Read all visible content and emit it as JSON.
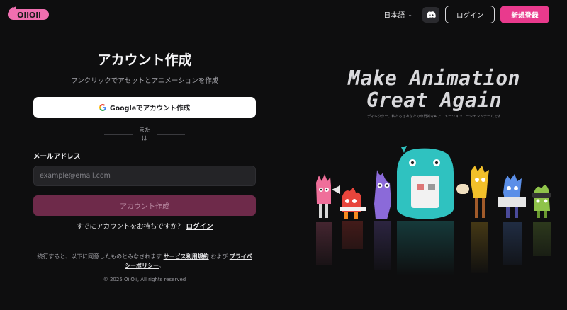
{
  "brand": {
    "logo_text": "OiiOii",
    "accent": "#e93a8d"
  },
  "header": {
    "language": "日本語",
    "login_label": "ログイン",
    "signup_label": "新規登録"
  },
  "form": {
    "title": "アカウント作成",
    "subtitle": "ワンクリックでアセットとアニメーションを作成",
    "google_label": "Googleでアカウント作成",
    "or_text": "または",
    "email_label": "メールアドレス",
    "email_placeholder": "example@email.com",
    "email_value": "",
    "create_label": "アカウント作成",
    "have_account_text": "すでにアカウントをお持ちですか？",
    "login_link": "ログイン",
    "terms_prefix": "続行すると、以下に同意したものとみなされます",
    "terms_link": "サービス利用規約",
    "terms_and": "および",
    "privacy_link": "プライバシーポリシー",
    "terms_suffix": "。",
    "copyright": "© 2025 OiiOii, All rights reserved"
  },
  "hero": {
    "line1": "Make Animation",
    "line2": "Great Again",
    "subtitle": "ディレクター、私たちはあなたの専門的なAIアニメーションエージェントチームです"
  }
}
